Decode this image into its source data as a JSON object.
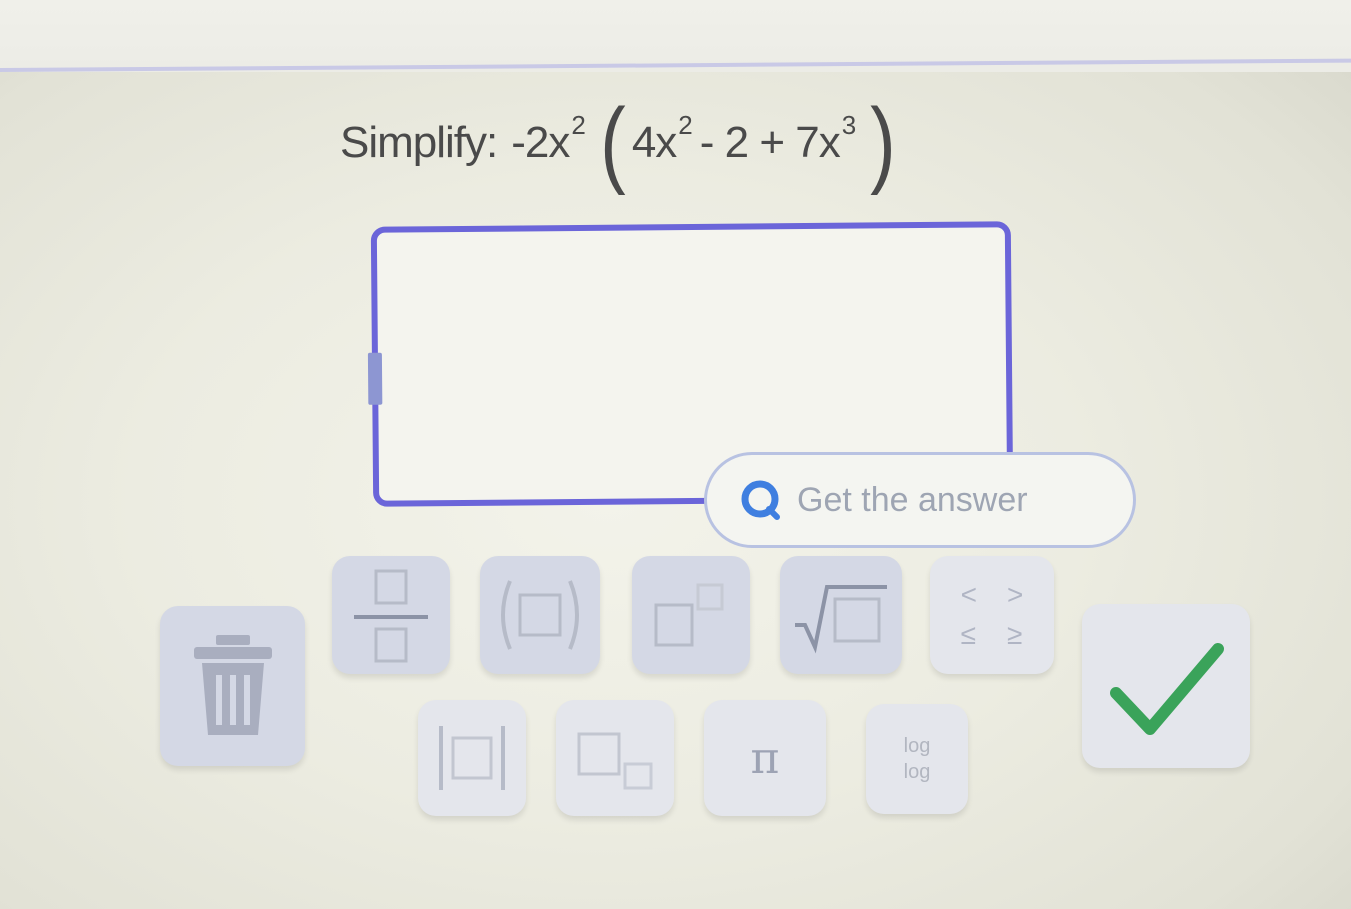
{
  "question": {
    "label": "Simplify:",
    "expr": {
      "lead": "-2x",
      "lead_exp": "2",
      "open": "(",
      "t1": "4x",
      "t1_exp": "2",
      "t2": "- 2 + 7x",
      "t2_exp": "3",
      "close": ")"
    }
  },
  "answer_input": {
    "value": ""
  },
  "get_answer": {
    "label": "Get the answer"
  },
  "keypad": {
    "pi": "π",
    "inequalities": [
      "<",
      ">",
      "≤",
      "≥"
    ],
    "log_top": "log",
    "log_bottom": "log"
  },
  "colors": {
    "accent": "#6b65d9",
    "check": "#3aa35a",
    "key_bg": "#d4d8e5"
  },
  "icons": [
    "trash-icon",
    "fraction-icon",
    "parentheses-icon",
    "exponent-icon",
    "sqrt-icon",
    "absolute-value-icon",
    "subscript-icon",
    "checkmark-icon",
    "search-icon"
  ]
}
